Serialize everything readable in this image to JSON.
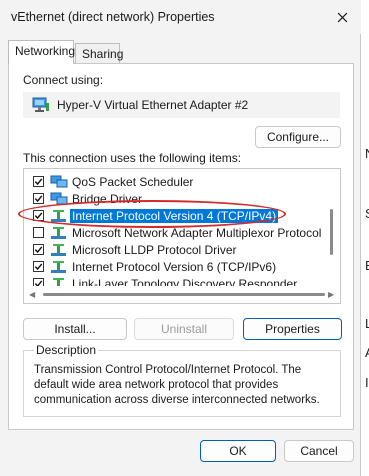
{
  "window": {
    "title": "vEthernet (direct network) Properties",
    "close_icon": "close-icon"
  },
  "tabs": [
    {
      "label": "Networking"
    },
    {
      "label": "Sharing"
    }
  ],
  "connect": {
    "label": "Connect using:",
    "adapter_name": "Hyper-V Virtual Ethernet Adapter #2",
    "adapter_icon": "network-adapter-icon",
    "configure_label": "Configure..."
  },
  "items": {
    "label": "This connection uses the following items:",
    "list": [
      {
        "label": "QoS Packet Scheduler",
        "checked": true,
        "icon": "service-icon"
      },
      {
        "label": "Bridge Driver",
        "checked": true,
        "icon": "service-icon"
      },
      {
        "label": "Internet Protocol Version 4 (TCP/IPv4)",
        "checked": true,
        "icon": "protocol-icon",
        "selected": true
      },
      {
        "label": "Microsoft Network Adapter Multiplexor Protocol",
        "checked": false,
        "icon": "protocol-icon"
      },
      {
        "label": "Microsoft LLDP Protocol Driver",
        "checked": true,
        "icon": "protocol-icon"
      },
      {
        "label": "Internet Protocol Version 6 (TCP/IPv6)",
        "checked": true,
        "icon": "protocol-icon"
      },
      {
        "label": "Link-Layer Topology Discovery Responder",
        "checked": true,
        "icon": "protocol-icon"
      }
    ]
  },
  "buttons": {
    "install": "Install...",
    "uninstall": "Uninstall",
    "properties": "Properties"
  },
  "description": {
    "label": "Description",
    "text": "Transmission Control Protocol/Internet Protocol. The default wide area network protocol that provides communication across diverse interconnected networks."
  },
  "footer": {
    "ok": "OK",
    "cancel": "Cancel"
  },
  "background_letters": [
    "N",
    "S",
    "B",
    "L",
    "A",
    "I"
  ],
  "colors": {
    "selection": "#0078d7",
    "annotation": "#d12b2b",
    "primary_border": "#005fb8"
  }
}
